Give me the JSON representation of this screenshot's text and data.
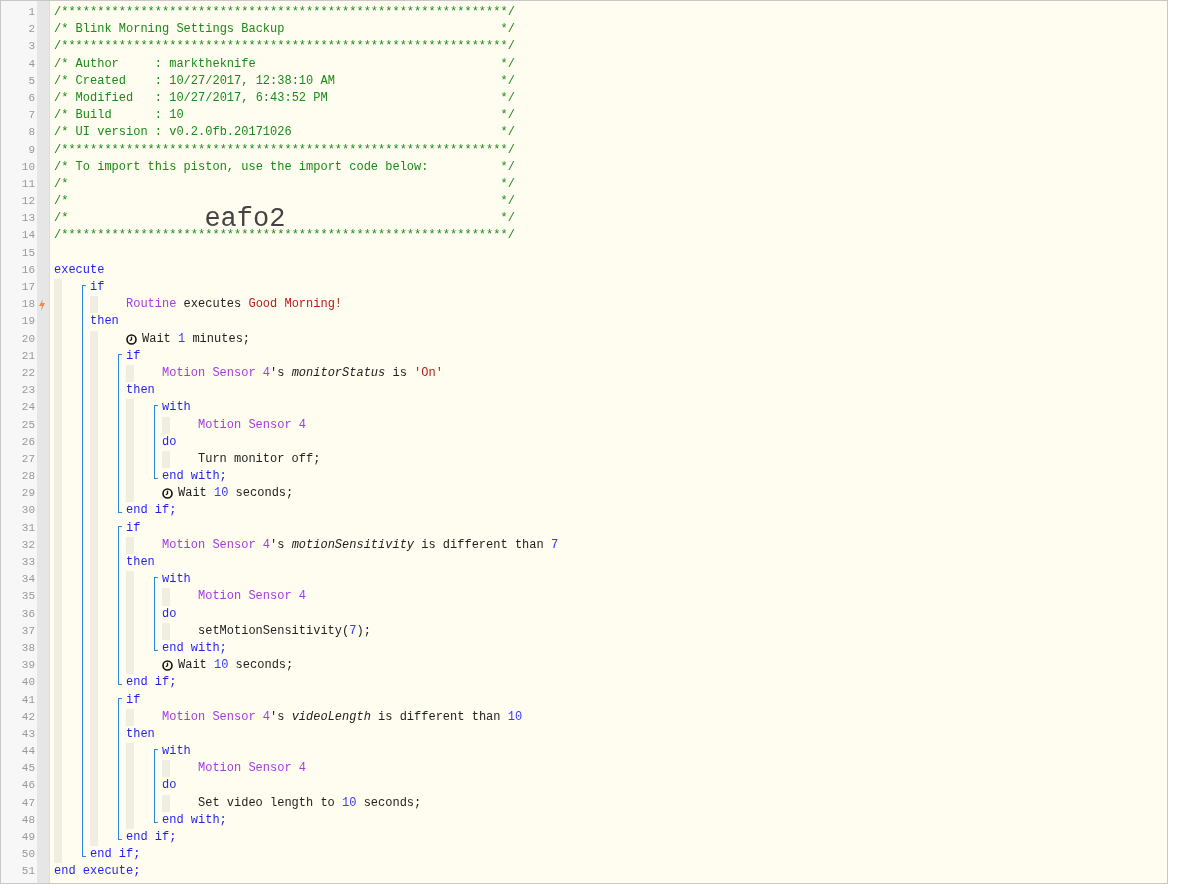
{
  "lines": [
    {
      "kind": "comment",
      "n": "1",
      "text": "/**************************************************************/"
    },
    {
      "kind": "comment",
      "n": "2",
      "text": "/* Blink Morning Settings Backup",
      "end": "*/"
    },
    {
      "kind": "comment",
      "n": "3",
      "text": "/**************************************************************/"
    },
    {
      "kind": "comment",
      "n": "4",
      "text": "/* Author     : marktheknife",
      "end": "*/"
    },
    {
      "kind": "comment",
      "n": "5",
      "text": "/* Created    : 10/27/2017, 12:38:10 AM",
      "end": "*/"
    },
    {
      "kind": "comment",
      "n": "6",
      "text": "/* Modified   : 10/27/2017, 6:43:52 PM",
      "end": "*/"
    },
    {
      "kind": "comment",
      "n": "7",
      "text": "/* Build      : 10",
      "end": "*/"
    },
    {
      "kind": "comment",
      "n": "8",
      "text": "/* UI version : v0.2.0fb.20171026",
      "end": "*/"
    },
    {
      "kind": "comment",
      "n": "9",
      "text": "/**************************************************************/"
    },
    {
      "kind": "comment",
      "n": "10",
      "text": "/* To import this piston, use the import code below:",
      "end": "*/"
    },
    {
      "kind": "comment",
      "n": "11",
      "text": "/*",
      "end": "*/"
    },
    {
      "kind": "comment",
      "n": "12",
      "text": "/*",
      "end": "*/"
    },
    {
      "kind": "comment",
      "n": "13",
      "text": "/*",
      "code": "eafo2",
      "end": "*/"
    },
    {
      "kind": "comment",
      "n": "14",
      "text": "/**************************************************************/"
    },
    {
      "kind": "blank",
      "n": "15"
    },
    {
      "kind": "statement",
      "n": "16",
      "tokens": [
        {
          "t": "execute",
          "kind": "keyword"
        }
      ],
      "children": [
        {
          "kind": "group",
          "lines": [
            {
              "kind": "statement",
              "n": "17",
              "tokens": [
                {
                  "t": "if",
                  "kind": "keyword"
                }
              ],
              "children": [
                {
                  "kind": "trigger",
                  "n": "18",
                  "tokens": [
                    {
                      "t": "Routine",
                      "kind": "device"
                    },
                    {
                      "t": " executes ",
                      "kind": "plain"
                    },
                    {
                      "t": "Good Morning!",
                      "kind": "value"
                    }
                  ]
                }
              ]
            },
            {
              "kind": "statement",
              "n": "19",
              "tokens": [
                {
                  "t": "then",
                  "kind": "keyword"
                }
              ],
              "children": [
                {
                  "kind": "wait",
                  "n": "20",
                  "tokens": [
                    {
                      "t": "Wait ",
                      "kind": "plain"
                    },
                    {
                      "t": "1",
                      "kind": "number"
                    },
                    {
                      "t": " minutes;",
                      "kind": "plain"
                    }
                  ]
                },
                {
                  "kind": "group",
                  "lines": [
                    {
                      "kind": "statement",
                      "n": "21",
                      "tokens": [
                        {
                          "t": "if",
                          "kind": "keyword"
                        }
                      ],
                      "children": [
                        {
                          "kind": "statement",
                          "n": "22",
                          "tokens": [
                            {
                              "t": "Motion Sensor 4",
                              "kind": "device"
                            },
                            {
                              "t": "'s ",
                              "kind": "plain"
                            },
                            {
                              "t": "monitorStatus",
                              "kind": "attribute"
                            },
                            {
                              "t": " is ",
                              "kind": "plain"
                            },
                            {
                              "t": "'On'",
                              "kind": "value"
                            }
                          ]
                        }
                      ]
                    },
                    {
                      "kind": "statement",
                      "n": "23",
                      "tokens": [
                        {
                          "t": "then",
                          "kind": "keyword"
                        }
                      ],
                      "children": [
                        {
                          "kind": "group",
                          "lines": [
                            {
                              "kind": "statement",
                              "n": "24",
                              "tokens": [
                                {
                                  "t": "with",
                                  "kind": "keyword"
                                }
                              ],
                              "children": [
                                {
                                  "kind": "statement",
                                  "n": "25",
                                  "tokens": [
                                    {
                                      "t": "Motion Sensor 4",
                                      "kind": "device"
                                    }
                                  ]
                                }
                              ]
                            },
                            {
                              "kind": "statement",
                              "n": "26",
                              "tokens": [
                                {
                                  "t": "do",
                                  "kind": "keyword"
                                }
                              ],
                              "children": [
                                {
                                  "kind": "statement",
                                  "n": "27",
                                  "tokens": [
                                    {
                                      "t": "Turn monitor off;",
                                      "kind": "plain"
                                    }
                                  ]
                                }
                              ]
                            },
                            {
                              "kind": "statement",
                              "n": "28",
                              "tokens": [
                                {
                                  "t": "end with;",
                                  "kind": "keyword"
                                }
                              ]
                            }
                          ]
                        },
                        {
                          "kind": "wait",
                          "n": "29",
                          "tokens": [
                            {
                              "t": "Wait ",
                              "kind": "plain"
                            },
                            {
                              "t": "10",
                              "kind": "number"
                            },
                            {
                              "t": " seconds;",
                              "kind": "plain"
                            }
                          ]
                        }
                      ]
                    },
                    {
                      "kind": "statement",
                      "n": "30",
                      "tokens": [
                        {
                          "t": "end if;",
                          "kind": "keyword"
                        }
                      ]
                    }
                  ]
                },
                {
                  "kind": "group",
                  "lines": [
                    {
                      "kind": "statement",
                      "n": "31",
                      "tokens": [
                        {
                          "t": "if",
                          "kind": "keyword"
                        }
                      ],
                      "children": [
                        {
                          "kind": "statement",
                          "n": "32",
                          "tokens": [
                            {
                              "t": "Motion Sensor 4",
                              "kind": "device"
                            },
                            {
                              "t": "'s ",
                              "kind": "plain"
                            },
                            {
                              "t": "motionSensitivity",
                              "kind": "attribute"
                            },
                            {
                              "t": " is different than ",
                              "kind": "plain"
                            },
                            {
                              "t": "7",
                              "kind": "number"
                            }
                          ]
                        }
                      ]
                    },
                    {
                      "kind": "statement",
                      "n": "33",
                      "tokens": [
                        {
                          "t": "then",
                          "kind": "keyword"
                        }
                      ],
                      "children": [
                        {
                          "kind": "group",
                          "lines": [
                            {
                              "kind": "statement",
                              "n": "34",
                              "tokens": [
                                {
                                  "t": "with",
                                  "kind": "keyword"
                                }
                              ],
                              "children": [
                                {
                                  "kind": "statement",
                                  "n": "35",
                                  "tokens": [
                                    {
                                      "t": "Motion Sensor 4",
                                      "kind": "device"
                                    }
                                  ]
                                }
                              ]
                            },
                            {
                              "kind": "statement",
                              "n": "36",
                              "tokens": [
                                {
                                  "t": "do",
                                  "kind": "keyword"
                                }
                              ],
                              "children": [
                                {
                                  "kind": "statement",
                                  "n": "37",
                                  "tokens": [
                                    {
                                      "t": "setMotionSensitivity(",
                                      "kind": "plain"
                                    },
                                    {
                                      "t": "7",
                                      "kind": "number"
                                    },
                                    {
                                      "t": ");",
                                      "kind": "plain"
                                    }
                                  ]
                                }
                              ]
                            },
                            {
                              "kind": "statement",
                              "n": "38",
                              "tokens": [
                                {
                                  "t": "end with;",
                                  "kind": "keyword"
                                }
                              ]
                            }
                          ]
                        },
                        {
                          "kind": "wait",
                          "n": "39",
                          "tokens": [
                            {
                              "t": "Wait ",
                              "kind": "plain"
                            },
                            {
                              "t": "10",
                              "kind": "number"
                            },
                            {
                              "t": " seconds;",
                              "kind": "plain"
                            }
                          ]
                        }
                      ]
                    },
                    {
                      "kind": "statement",
                      "n": "40",
                      "tokens": [
                        {
                          "t": "end if;",
                          "kind": "keyword"
                        }
                      ]
                    }
                  ]
                },
                {
                  "kind": "group",
                  "lines": [
                    {
                      "kind": "statement",
                      "n": "41",
                      "tokens": [
                        {
                          "t": "if",
                          "kind": "keyword"
                        }
                      ],
                      "children": [
                        {
                          "kind": "statement",
                          "n": "42",
                          "tokens": [
                            {
                              "t": "Motion Sensor 4",
                              "kind": "device"
                            },
                            {
                              "t": "'s ",
                              "kind": "plain"
                            },
                            {
                              "t": "videoLength",
                              "kind": "attribute"
                            },
                            {
                              "t": " is different than ",
                              "kind": "plain"
                            },
                            {
                              "t": "10",
                              "kind": "number"
                            }
                          ]
                        }
                      ]
                    },
                    {
                      "kind": "statement",
                      "n": "43",
                      "tokens": [
                        {
                          "t": "then",
                          "kind": "keyword"
                        }
                      ],
                      "children": [
                        {
                          "kind": "group",
                          "lines": [
                            {
                              "kind": "statement",
                              "n": "44",
                              "tokens": [
                                {
                                  "t": "with",
                                  "kind": "keyword"
                                }
                              ],
                              "children": [
                                {
                                  "kind": "statement",
                                  "n": "45",
                                  "tokens": [
                                    {
                                      "t": "Motion Sensor 4",
                                      "kind": "device"
                                    }
                                  ]
                                }
                              ]
                            },
                            {
                              "kind": "statement",
                              "n": "46",
                              "tokens": [
                                {
                                  "t": "do",
                                  "kind": "keyword"
                                }
                              ],
                              "children": [
                                {
                                  "kind": "statement",
                                  "n": "47",
                                  "tokens": [
                                    {
                                      "t": "Set video length to ",
                                      "kind": "plain"
                                    },
                                    {
                                      "t": "10",
                                      "kind": "number"
                                    },
                                    {
                                      "t": " seconds;",
                                      "kind": "plain"
                                    }
                                  ]
                                }
                              ]
                            },
                            {
                              "kind": "statement",
                              "n": "48",
                              "tokens": [
                                {
                                  "t": "end with;",
                                  "kind": "keyword"
                                }
                              ]
                            }
                          ]
                        }
                      ]
                    },
                    {
                      "kind": "statement",
                      "n": "49",
                      "tokens": [
                        {
                          "t": "end if;",
                          "kind": "keyword"
                        }
                      ]
                    }
                  ]
                }
              ]
            },
            {
              "kind": "statement",
              "n": "50",
              "tokens": [
                {
                  "t": "end if;",
                  "kind": "keyword"
                }
              ]
            }
          ]
        }
      ]
    },
    {
      "kind": "statement",
      "n": "51",
      "tokens": [
        {
          "t": "end execute;",
          "kind": "keyword"
        }
      ]
    }
  ]
}
